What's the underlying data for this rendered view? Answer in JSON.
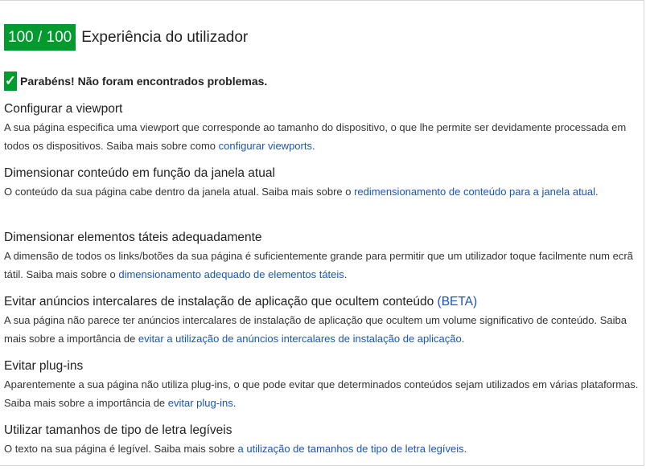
{
  "header": {
    "score": "100 / 100",
    "title": "Experiência do utilizador"
  },
  "congrats": {
    "check_icon": "checkmark-icon",
    "text": "Parabéns! Não foram encontrados problemas."
  },
  "rules": [
    {
      "title": "Configurar a viewport",
      "title_suffix": "",
      "desc": "A sua página especifica uma viewport que corresponde ao tamanho do dispositivo, o que lhe permite ser devidamente processada em todos os dispositivos. Saiba mais sobre como ",
      "link": "configurar viewports",
      "desc_end": "."
    },
    {
      "title": "Dimensionar conteúdo em função da janela atual",
      "title_suffix": "",
      "desc": "O conteúdo da sua página cabe dentro da janela atual. Saiba mais sobre o ",
      "link": "redimensionamento de conteúdo para a janela atual",
      "desc_end": "."
    },
    {
      "title": "Dimensionar elementos táteis adequadamente",
      "title_suffix": "",
      "desc": "A dimensão de todos os links/botões da sua página é suficientemente grande para permitir que um utilizador toque facilmente num ecrã tátil. Saiba mais sobre o ",
      "link": "dimensionamento adequado de elementos táteis",
      "desc_end": "."
    },
    {
      "title": "Evitar anúncios intercalares de instalação de aplicação que ocultem conteúdo ",
      "title_suffix": "(BETA)",
      "desc": "A sua página não parece ter anúncios intercalares de instalação de aplicação que ocultem um volume significativo de conteúdo. Saiba mais sobre a importância de ",
      "link": "evitar a utilização de anúncios intercalares de instalação de aplicação",
      "desc_end": "."
    },
    {
      "title": "Evitar plug-ins",
      "title_suffix": "",
      "desc": "Aparentemente a sua página não utiliza plug-ins, o que pode evitar que determinados conteúdos sejam utilizados em várias plataformas. Saiba mais sobre a importância de ",
      "link": "evitar plug-ins",
      "desc_end": "."
    },
    {
      "title": "Utilizar tamanhos de tipo de letra legíveis",
      "title_suffix": "",
      "desc": "O texto na sua página é legível. Saiba mais sobre ",
      "link": "a utilização de tamanhos de tipo de letra legíveis",
      "desc_end": "."
    }
  ],
  "colors": {
    "score_bg": "#009a2e",
    "link": "#1a55b5"
  }
}
